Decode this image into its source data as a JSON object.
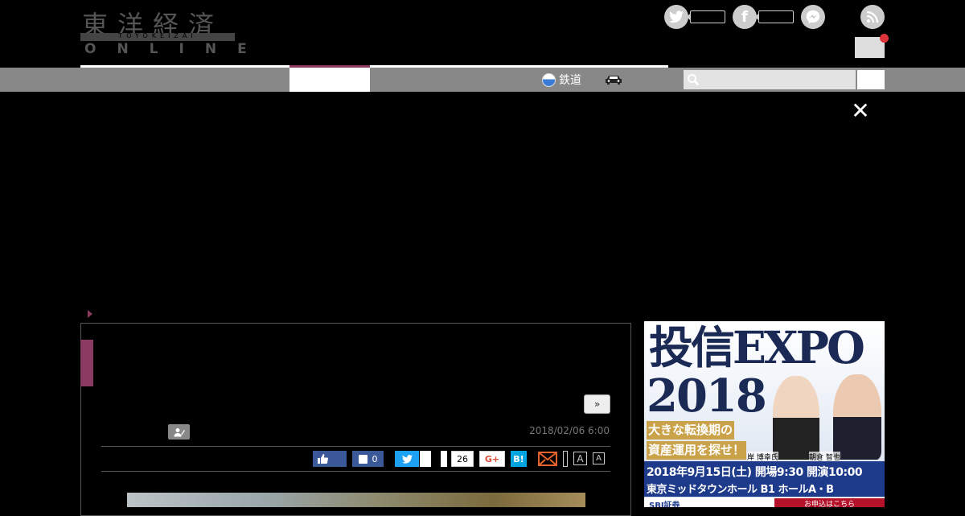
{
  "header": {
    "logo_kanji": "東洋経済",
    "logo_sub": "TOYOKEIZAI",
    "logo_online": "ONLINE"
  },
  "nav": {
    "rail_label": "鉄道"
  },
  "search": {
    "placeholder": ""
  },
  "article": {
    "next_label": "»",
    "date": "2018/02/06 6:00",
    "share_fb_count": "0",
    "share_count": "26",
    "gplus_label": "G+",
    "hatena_label": "B!",
    "font_large_label": "A",
    "font_small_label": "A"
  },
  "ad": {
    "title": "投信EXPO",
    "year": "2018",
    "tagline_1": "大きな転換期の",
    "tagline_2": "資産運用を探せ！",
    "name_1": "岸 博幸氏",
    "name_2": "朝倉 智也",
    "date": "2018年9月15日(土) 開場9:30 開演10:00",
    "venue": "東京ミッドタウンホール B1 ホールA・B",
    "sponsor": "SBI証券",
    "cta": "お申込はこちら"
  },
  "colors": {
    "accent": "#8b3a62",
    "nav_bg": "#888888",
    "ad_blue": "#1e3a8a"
  }
}
